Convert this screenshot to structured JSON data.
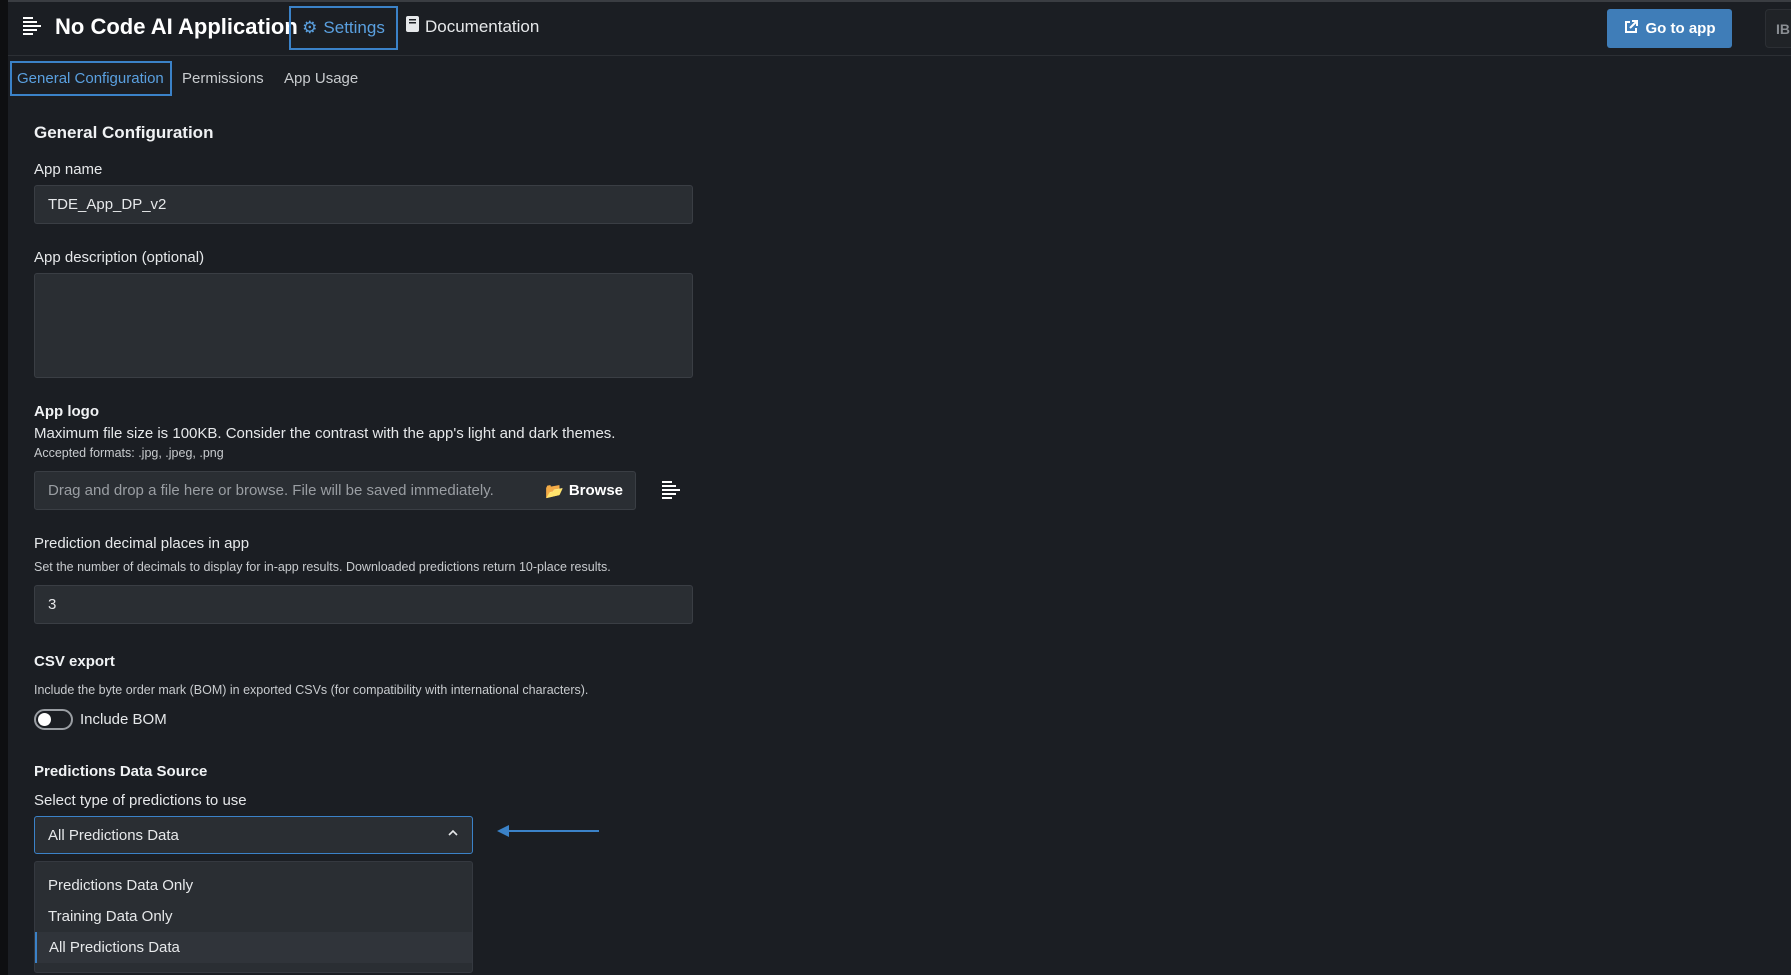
{
  "header": {
    "title": "No Code AI Application",
    "nav": [
      {
        "label": "Settings",
        "icon": "gear-icon"
      },
      {
        "label": "Documentation",
        "icon": "book-icon"
      }
    ],
    "go_to_app": "Go to app",
    "avatar": "IB"
  },
  "tabs": [
    {
      "label": "General Configuration",
      "active": true
    },
    {
      "label": "Permissions"
    },
    {
      "label": "App Usage"
    }
  ],
  "section_title": "General Configuration",
  "app_name": {
    "label": "App name",
    "value": "TDE_App_DP_v2"
  },
  "app_description": {
    "label": "App description (optional)",
    "value": ""
  },
  "app_logo": {
    "label": "App logo",
    "help": "Maximum file size is 100KB. Consider the contrast with the app's light and dark themes.",
    "formats": "Accepted formats: .jpg, .jpeg, .png",
    "placeholder": "Drag and drop a file here or browse. File will be saved immediately.",
    "browse": "Browse"
  },
  "decimals": {
    "label": "Prediction decimal places in app",
    "help": "Set the number of decimals to display for in-app results. Downloaded predictions return 10-place results.",
    "value": "3"
  },
  "csv": {
    "label": "CSV export",
    "help": "Include the byte order mark (BOM) in exported CSVs (for compatibility with international characters).",
    "toggle_label": "Include BOM",
    "enabled": false
  },
  "predictions_source": {
    "label": "Predictions Data Source",
    "select_label": "Select type of predictions to use",
    "selected": "All Predictions Data",
    "options": [
      "Predictions Data Only",
      "Training Data Only",
      "All Predictions Data"
    ]
  },
  "colors": {
    "accent": "#3b82c8",
    "button": "#3f7db8",
    "background": "#1b1e23"
  }
}
